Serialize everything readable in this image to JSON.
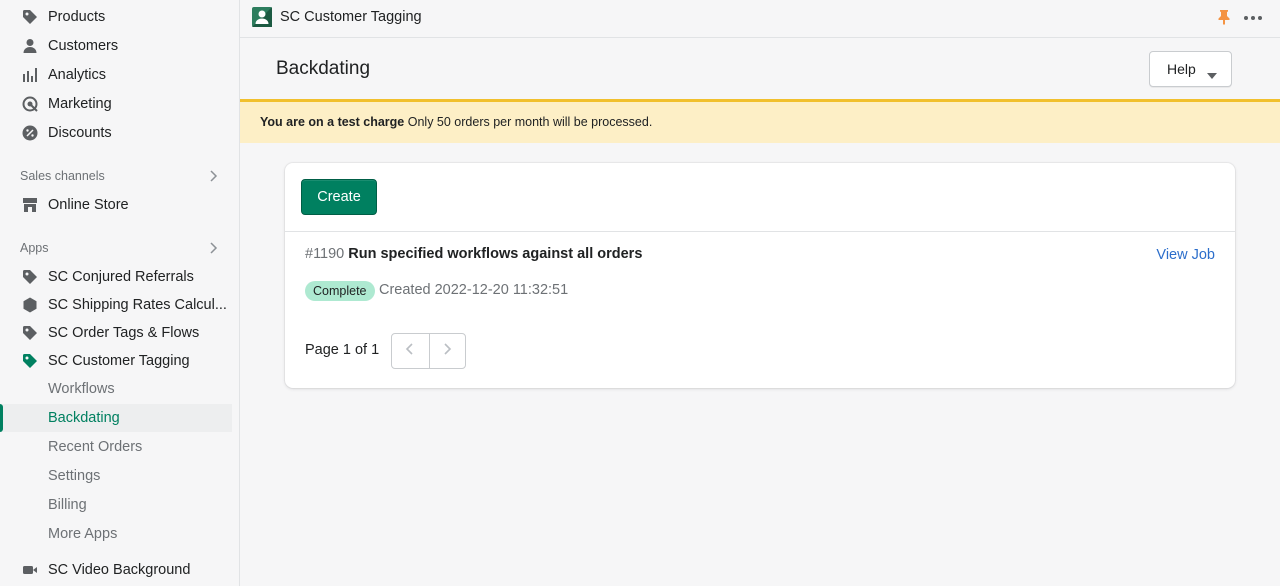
{
  "sidebar": {
    "main_items": [
      {
        "label": "Products",
        "icon": "tag-icon"
      },
      {
        "label": "Customers",
        "icon": "person-icon"
      },
      {
        "label": "Analytics",
        "icon": "bar-chart-icon"
      },
      {
        "label": "Marketing",
        "icon": "target-icon"
      },
      {
        "label": "Discounts",
        "icon": "discount-icon"
      }
    ],
    "sales_channels": {
      "heading": "Sales channels",
      "items": [
        {
          "label": "Online Store",
          "icon": "store-icon"
        }
      ]
    },
    "apps": {
      "heading": "Apps",
      "items": [
        {
          "label": "SC Conjured Referrals",
          "icon": "tag-icon"
        },
        {
          "label": "SC Shipping Rates Calcul...",
          "icon": "hexagon-icon"
        },
        {
          "label": "SC Order Tags & Flows",
          "icon": "tag-icon"
        },
        {
          "label": "SC Customer Tagging",
          "icon": "tag-icon"
        }
      ],
      "sub_items": [
        {
          "label": "Workflows"
        },
        {
          "label": "Backdating",
          "active": true
        },
        {
          "label": "Recent Orders"
        },
        {
          "label": "Settings"
        },
        {
          "label": "Billing"
        },
        {
          "label": "More Apps"
        }
      ],
      "last_item": {
        "label": "SC Video Background",
        "icon": "video-icon"
      }
    }
  },
  "topbar": {
    "app_name": "SC Customer Tagging"
  },
  "page": {
    "title": "Backdating",
    "help_label": "Help"
  },
  "banner": {
    "bold": "You are on a test charge",
    "text": "Only 50 orders per month will be processed."
  },
  "card": {
    "create_label": "Create",
    "job": {
      "id": "#1190",
      "name": "Run specified workflows against all orders",
      "view_label": "View Job",
      "status": "Complete",
      "created": "Created 2022-12-20 11:32:51"
    },
    "pagination": {
      "text": "Page 1 of 1"
    }
  },
  "colors": {
    "accent": "#008060",
    "banner_bg": "#fdefc6",
    "banner_border": "#f1c02d",
    "badge_bg": "#aee9d1",
    "link": "#2c6ecb",
    "pin": "#f49342"
  }
}
